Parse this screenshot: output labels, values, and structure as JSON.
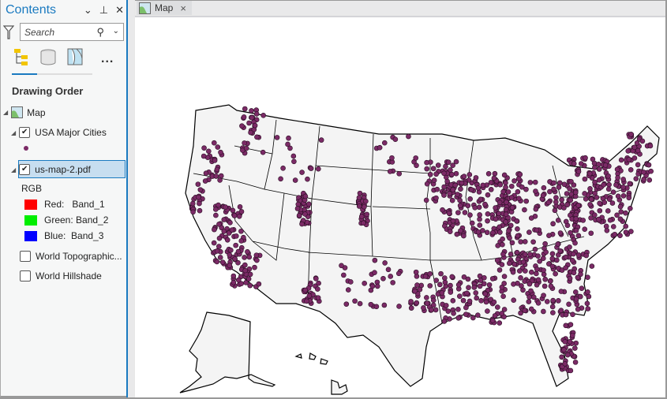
{
  "panel": {
    "title": "Contents",
    "header_icons": [
      "chevron-down",
      "pin",
      "close"
    ],
    "search": {
      "placeholder": "Search",
      "value": ""
    },
    "view_tabs": [
      "list-by-drawing-order",
      "list-by-data-source",
      "list-by-selection"
    ],
    "more_label": "...",
    "section_title": "Drawing Order",
    "layers": {
      "map": {
        "label": "Map"
      },
      "cities": {
        "label": "USA Major Cities",
        "checked": true,
        "symbol_color": "#7b2a66"
      },
      "pdf": {
        "label": "us-map-2.pdf",
        "checked": true,
        "selected": true,
        "renderer": "RGB",
        "bands": [
          {
            "label": "Red:   Band_1",
            "color": "#ff0000"
          },
          {
            "label": "Green: Band_2",
            "color": "#00ee00"
          },
          {
            "label": "Blue:  Band_3",
            "color": "#0000ff"
          }
        ]
      },
      "topo": {
        "label": "World Topographic...",
        "checked": false
      },
      "hillshade": {
        "label": "World Hillshade",
        "checked": false
      }
    }
  },
  "map_tab": {
    "label": "Map",
    "close": "×"
  },
  "map": {
    "land_color": "#f4f4f4",
    "point_color": "#7b2a66",
    "point_stroke": "#2a0f24"
  }
}
